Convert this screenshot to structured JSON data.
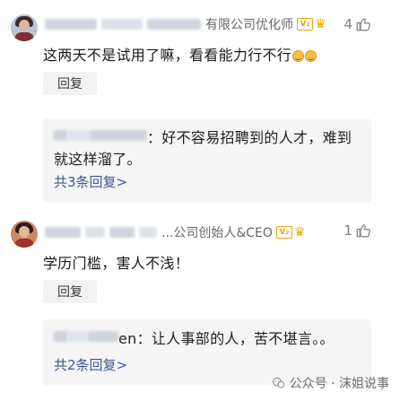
{
  "comments": [
    {
      "author_visible_suffix": "有限公司优化师",
      "badge_text": "V₂",
      "likes": "4",
      "text": "这两天不是试用了嘛，看看能力行不行",
      "reply_button": "回复",
      "sub_reply": {
        "text_line1": "：好不容易招聘到的人才，难到",
        "text_line2": "就这样溜了。",
        "more": "共3条回复>"
      }
    },
    {
      "author_visible_suffix": "...公司创始人&CEO",
      "badge_text": "V₂",
      "likes": "1",
      "text": "学历门槛，害人不浅！",
      "reply_button": "回复",
      "sub_reply": {
        "name_visible_suffix": "en",
        "text_line1": "：让人事部的人，苦不堪言。。",
        "more": "共2条回复>"
      }
    }
  ],
  "watermark": {
    "text": "公众号 · 沫姐说事"
  },
  "colors": {
    "badge": "#e3a31a",
    "link": "#3b5998",
    "reply_bg": "#f5f5f5"
  }
}
